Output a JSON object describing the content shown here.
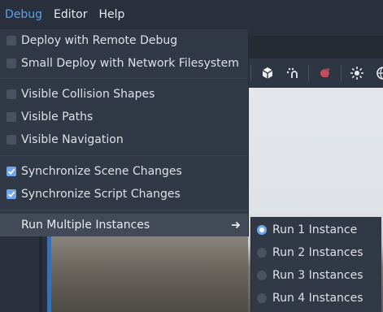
{
  "menubar": {
    "items": [
      {
        "label": "Debug"
      },
      {
        "label": "Editor"
      },
      {
        "label": "Help"
      }
    ]
  },
  "debug_menu": {
    "items": [
      {
        "label": "Deploy with Remote Debug",
        "checked": false
      },
      {
        "label": "Small Deploy with Network Filesystem",
        "checked": false
      },
      {
        "label": "Visible Collision Shapes",
        "checked": false
      },
      {
        "label": "Visible Paths",
        "checked": false
      },
      {
        "label": "Visible Navigation",
        "checked": false
      },
      {
        "label": "Synchronize Scene Changes",
        "checked": true
      },
      {
        "label": "Synchronize Script Changes",
        "checked": true
      },
      {
        "label": "Run Multiple Instances",
        "submenu": true
      }
    ]
  },
  "instances_submenu": {
    "items": [
      {
        "label": "Run 1 Instance",
        "selected": true
      },
      {
        "label": "Run 2 Instances",
        "selected": false
      },
      {
        "label": "Run 3 Instances",
        "selected": false
      },
      {
        "label": "Run 4 Instances",
        "selected": false
      }
    ]
  },
  "colors": {
    "accent": "#5aa0ec",
    "checkbox_checked": "#6fa7ea",
    "menu_bg": "#323946",
    "hover_bg": "#424a58"
  },
  "icons": [
    "cube-icon",
    "snap-icon",
    "gizmo-icon",
    "sun-icon",
    "globe-icon",
    "chevron-right-icon",
    "checkmark-icon"
  ]
}
